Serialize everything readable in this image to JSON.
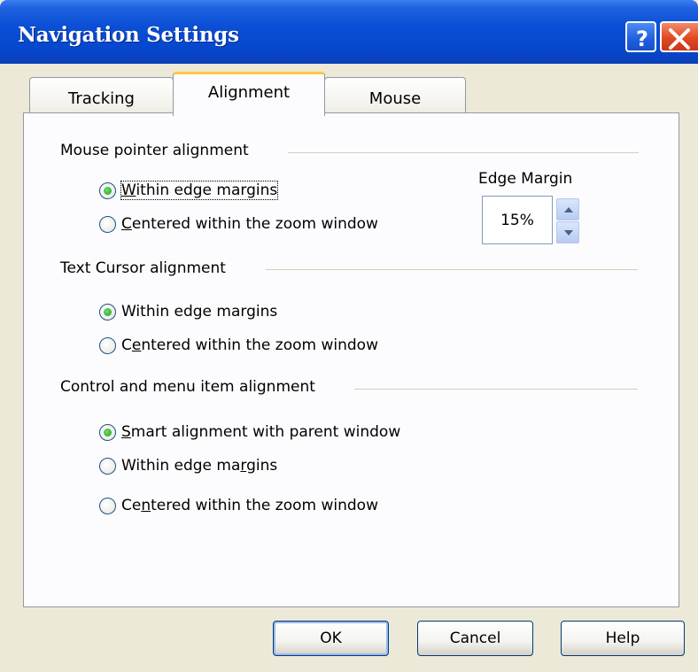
{
  "window": {
    "title": "Navigation Settings"
  },
  "tabs": [
    {
      "label": "Tracking",
      "selected": false
    },
    {
      "label": "Alignment",
      "selected": true
    },
    {
      "label": "Mouse",
      "selected": false
    }
  ],
  "mouse_pointer_group": {
    "title": "Mouse pointer alignment",
    "options": [
      {
        "pre": "",
        "key": "W",
        "post": "ithin edge margins",
        "checked": true
      },
      {
        "pre": "",
        "key": "C",
        "post": "entered within the zoom window",
        "checked": false
      }
    ]
  },
  "edge_margin": {
    "label": "Edge Margin",
    "value": "15%"
  },
  "text_cursor_group": {
    "title": "Text Cursor alignment",
    "options": [
      {
        "pre": "Within edge margins",
        "key": "",
        "post": "",
        "checked": true
      },
      {
        "pre": "C",
        "key": "e",
        "post": "ntered within the zoom window",
        "checked": false
      }
    ]
  },
  "control_group": {
    "title": "Control and menu item alignment",
    "options": [
      {
        "pre": "",
        "key": "S",
        "post": "mart alignment with parent window",
        "checked": true
      },
      {
        "pre": "Within edge ma",
        "key": "r",
        "post": "gins",
        "checked": false
      },
      {
        "pre": "Ce",
        "key": "n",
        "post": "tered within the zoom window",
        "checked": false
      }
    ]
  },
  "buttons": {
    "ok": "OK",
    "cancel": "Cancel",
    "help": "Help"
  },
  "colors": {
    "titlebar": "#0a4fd6",
    "tab_highlight": "#ffc83c",
    "radio_dot": "#1f9a1c"
  }
}
